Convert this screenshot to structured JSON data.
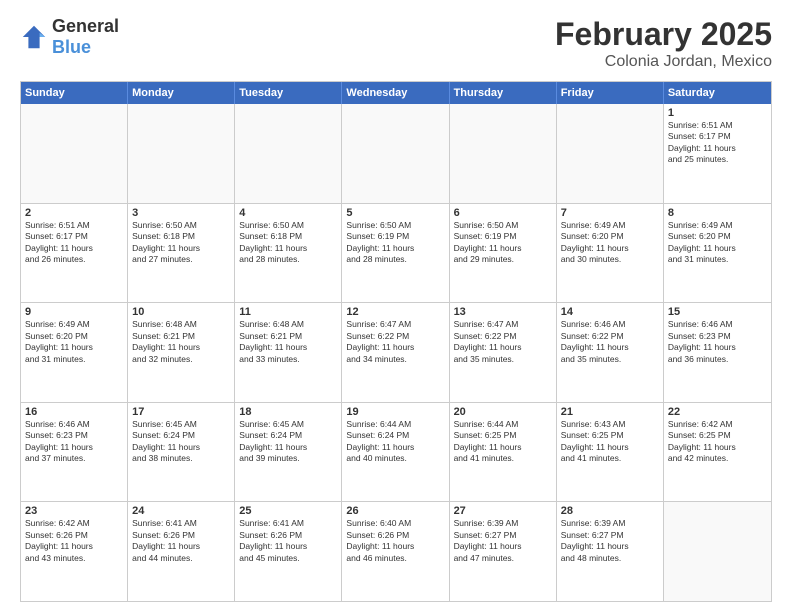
{
  "header": {
    "logo": {
      "general": "General",
      "blue": "Blue"
    },
    "month": "February 2025",
    "location": "Colonia Jordan, Mexico"
  },
  "weekdays": [
    "Sunday",
    "Monday",
    "Tuesday",
    "Wednesday",
    "Thursday",
    "Friday",
    "Saturday"
  ],
  "rows": [
    [
      {
        "day": "",
        "info": ""
      },
      {
        "day": "",
        "info": ""
      },
      {
        "day": "",
        "info": ""
      },
      {
        "day": "",
        "info": ""
      },
      {
        "day": "",
        "info": ""
      },
      {
        "day": "",
        "info": ""
      },
      {
        "day": "1",
        "info": "Sunrise: 6:51 AM\nSunset: 6:17 PM\nDaylight: 11 hours\nand 25 minutes."
      }
    ],
    [
      {
        "day": "2",
        "info": "Sunrise: 6:51 AM\nSunset: 6:17 PM\nDaylight: 11 hours\nand 26 minutes."
      },
      {
        "day": "3",
        "info": "Sunrise: 6:50 AM\nSunset: 6:18 PM\nDaylight: 11 hours\nand 27 minutes."
      },
      {
        "day": "4",
        "info": "Sunrise: 6:50 AM\nSunset: 6:18 PM\nDaylight: 11 hours\nand 28 minutes."
      },
      {
        "day": "5",
        "info": "Sunrise: 6:50 AM\nSunset: 6:19 PM\nDaylight: 11 hours\nand 28 minutes."
      },
      {
        "day": "6",
        "info": "Sunrise: 6:50 AM\nSunset: 6:19 PM\nDaylight: 11 hours\nand 29 minutes."
      },
      {
        "day": "7",
        "info": "Sunrise: 6:49 AM\nSunset: 6:20 PM\nDaylight: 11 hours\nand 30 minutes."
      },
      {
        "day": "8",
        "info": "Sunrise: 6:49 AM\nSunset: 6:20 PM\nDaylight: 11 hours\nand 31 minutes."
      }
    ],
    [
      {
        "day": "9",
        "info": "Sunrise: 6:49 AM\nSunset: 6:20 PM\nDaylight: 11 hours\nand 31 minutes."
      },
      {
        "day": "10",
        "info": "Sunrise: 6:48 AM\nSunset: 6:21 PM\nDaylight: 11 hours\nand 32 minutes."
      },
      {
        "day": "11",
        "info": "Sunrise: 6:48 AM\nSunset: 6:21 PM\nDaylight: 11 hours\nand 33 minutes."
      },
      {
        "day": "12",
        "info": "Sunrise: 6:47 AM\nSunset: 6:22 PM\nDaylight: 11 hours\nand 34 minutes."
      },
      {
        "day": "13",
        "info": "Sunrise: 6:47 AM\nSunset: 6:22 PM\nDaylight: 11 hours\nand 35 minutes."
      },
      {
        "day": "14",
        "info": "Sunrise: 6:46 AM\nSunset: 6:22 PM\nDaylight: 11 hours\nand 35 minutes."
      },
      {
        "day": "15",
        "info": "Sunrise: 6:46 AM\nSunset: 6:23 PM\nDaylight: 11 hours\nand 36 minutes."
      }
    ],
    [
      {
        "day": "16",
        "info": "Sunrise: 6:46 AM\nSunset: 6:23 PM\nDaylight: 11 hours\nand 37 minutes."
      },
      {
        "day": "17",
        "info": "Sunrise: 6:45 AM\nSunset: 6:24 PM\nDaylight: 11 hours\nand 38 minutes."
      },
      {
        "day": "18",
        "info": "Sunrise: 6:45 AM\nSunset: 6:24 PM\nDaylight: 11 hours\nand 39 minutes."
      },
      {
        "day": "19",
        "info": "Sunrise: 6:44 AM\nSunset: 6:24 PM\nDaylight: 11 hours\nand 40 minutes."
      },
      {
        "day": "20",
        "info": "Sunrise: 6:44 AM\nSunset: 6:25 PM\nDaylight: 11 hours\nand 41 minutes."
      },
      {
        "day": "21",
        "info": "Sunrise: 6:43 AM\nSunset: 6:25 PM\nDaylight: 11 hours\nand 41 minutes."
      },
      {
        "day": "22",
        "info": "Sunrise: 6:42 AM\nSunset: 6:25 PM\nDaylight: 11 hours\nand 42 minutes."
      }
    ],
    [
      {
        "day": "23",
        "info": "Sunrise: 6:42 AM\nSunset: 6:26 PM\nDaylight: 11 hours\nand 43 minutes."
      },
      {
        "day": "24",
        "info": "Sunrise: 6:41 AM\nSunset: 6:26 PM\nDaylight: 11 hours\nand 44 minutes."
      },
      {
        "day": "25",
        "info": "Sunrise: 6:41 AM\nSunset: 6:26 PM\nDaylight: 11 hours\nand 45 minutes."
      },
      {
        "day": "26",
        "info": "Sunrise: 6:40 AM\nSunset: 6:26 PM\nDaylight: 11 hours\nand 46 minutes."
      },
      {
        "day": "27",
        "info": "Sunrise: 6:39 AM\nSunset: 6:27 PM\nDaylight: 11 hours\nand 47 minutes."
      },
      {
        "day": "28",
        "info": "Sunrise: 6:39 AM\nSunset: 6:27 PM\nDaylight: 11 hours\nand 48 minutes."
      },
      {
        "day": "",
        "info": ""
      }
    ]
  ]
}
